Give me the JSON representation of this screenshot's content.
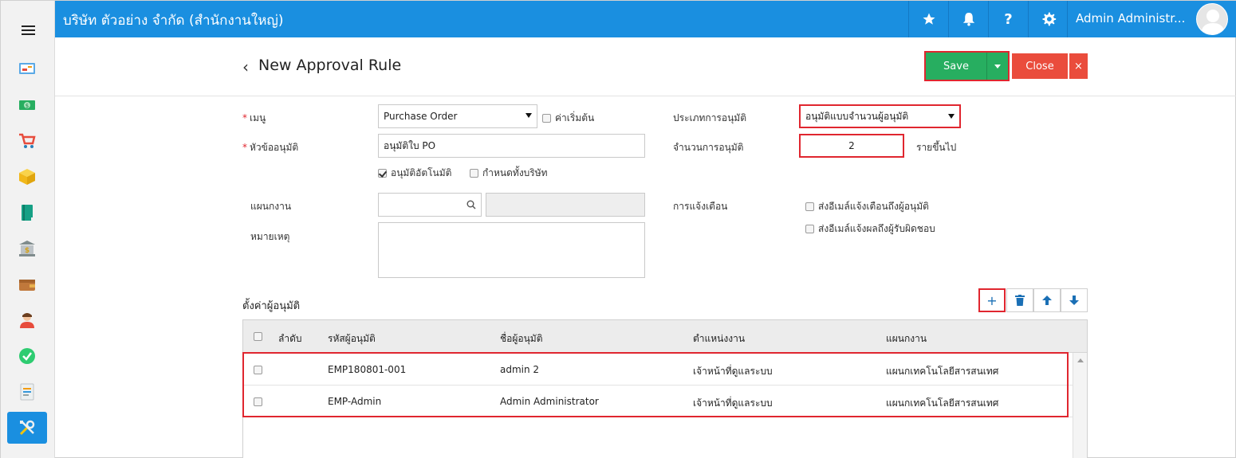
{
  "app": {
    "company": "บริษัท ตัวอย่าง จำกัด (สำนักงานใหญ่)",
    "user_name": "Admin Administr...",
    "accent": "#1a8fe0"
  },
  "sidebar": {
    "menu_icon": "hamburger-icon",
    "items": [
      {
        "icon": "dashboard-icon"
      },
      {
        "icon": "money-icon"
      },
      {
        "icon": "cart-icon"
      },
      {
        "icon": "box-icon"
      },
      {
        "icon": "book-icon"
      },
      {
        "icon": "bank-icon"
      },
      {
        "icon": "wallet-icon"
      },
      {
        "icon": "person-icon"
      },
      {
        "icon": "check-circle-icon"
      },
      {
        "icon": "document-icon"
      },
      {
        "icon": "tools-icon",
        "active": true
      }
    ]
  },
  "topbar": {
    "icons": [
      "star-icon",
      "bell-icon",
      "help-icon",
      "gear-icon"
    ],
    "help_label": "?"
  },
  "header": {
    "back": "‹",
    "title": "New Approval Rule",
    "save_label": "Save",
    "close_label": "Close",
    "close_x": "×"
  },
  "form": {
    "menu_label": "เมนู",
    "menu_value": "Purchase Order",
    "default_label": "ค่าเริ่มต้น",
    "topic_label": "หัวข้ออนุมัติ",
    "topic_value": "อนุมัติใบ PO",
    "auto_approve_label": "อนุมัติอัตโนมัติ",
    "all_company_label": "กำหนดทั้งบริษัท",
    "department_label": "แผนกงาน",
    "department_code": "",
    "department_name": "",
    "note_label": "หมายเหตุ",
    "note_value": "",
    "approval_type_label": "ประเภทการอนุมัติ",
    "approval_type_value": "อนุมัติแบบจำนวนผู้อนุมัติ",
    "approval_count_label": "จำนวนการอนุมัติ",
    "approval_count_value": "2",
    "approval_count_suffix": "รายขึ้นไป",
    "notify_label": "การแจ้งเตือน",
    "notify_approver_label": "ส่งอีเมล์แจ้งเตือนถึงผู้อนุมัติ",
    "notify_owner_label": "ส่งอีเมล์แจ้งผลถึงผู้รับผิดชอบ"
  },
  "approvers": {
    "title": "ตั้งค่าผู้อนุมัติ",
    "add_label": "+",
    "columns": [
      "ลำดับ",
      "รหัสผู้อนุมัติ",
      "ชื่อผู้อนุมัติ",
      "ตำแหน่งงาน",
      "แผนกงาน"
    ],
    "rows": [
      {
        "code": "EMP180801-001",
        "name": "admin 2",
        "position": "เจ้าหน้าที่ดูแลระบบ",
        "department": "แผนกเทคโนโลยีสารสนเทศ"
      },
      {
        "code": "EMP-Admin",
        "name": "Admin Administrator",
        "position": "เจ้าหน้าที่ดูแลระบบ",
        "department": "แผนกเทคโนโลยีสารสนเทศ"
      }
    ]
  }
}
